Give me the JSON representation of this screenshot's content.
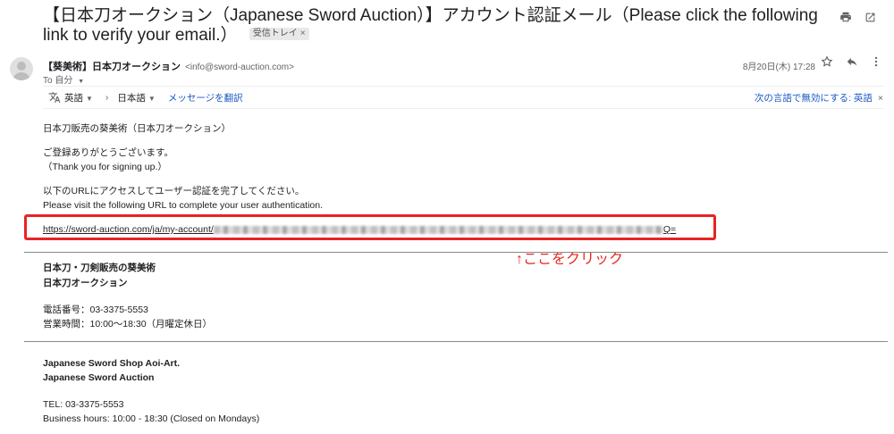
{
  "email": {
    "subject": "【日本刀オークション（Japanese Sword Auction）】アカウント認証メール（Please click the following link to verify your email.）",
    "inbox_label": "受信トレイ",
    "inbox_label_close": "×",
    "sender_name": "【葵美術】日本刀オークション",
    "sender_email": "<info@sword-auction.com>",
    "to_line": "To 自分",
    "date": "8月20日(木) 17:28"
  },
  "translate": {
    "from_lang": "英語",
    "arrow": "›",
    "to_lang": "日本語",
    "translate_link": "メッセージを翻訳",
    "disable_text": "次の言語で無効にする: 英語",
    "close": "×"
  },
  "body": {
    "shop_name": "日本刀販売の葵美術（日本刀オークション）",
    "thanks_ja": "ご登録ありがとうございます。",
    "thanks_en": "（Thank you for signing up.）",
    "instruction_ja": "以下のURLにアクセスしてユーザー認証を完了してください。",
    "instruction_en": "Please visit the following URL to complete your user authentication.",
    "url_prefix": "https://sword-auction.com/ja/my-account/",
    "url_suffix": "Q=",
    "annotation": "↑ここをクリック",
    "sig_ja_line1": "日本刀・刀剣販売の葵美術",
    "sig_ja_line2": "日本刀オークション",
    "phone_ja": "電話番号：03-3375-5553",
    "hours_ja": "営業時間：10:00〜18:30（月曜定休日）",
    "sig_en_line1": "Japanese Sword Shop Aoi-Art.",
    "sig_en_line2": "Japanese Sword Auction",
    "phone_en": "TEL: 03-3375-5553",
    "hours_en": "Business hours: 10:00 - 18:30 (Closed on Mondays)"
  },
  "icons": {
    "print": "print-icon",
    "open_new": "open-in-new-icon",
    "star": "star-icon",
    "reply": "reply-icon",
    "more": "more-vert-icon",
    "translate": "translate-icon",
    "avatar": "avatar-icon"
  }
}
